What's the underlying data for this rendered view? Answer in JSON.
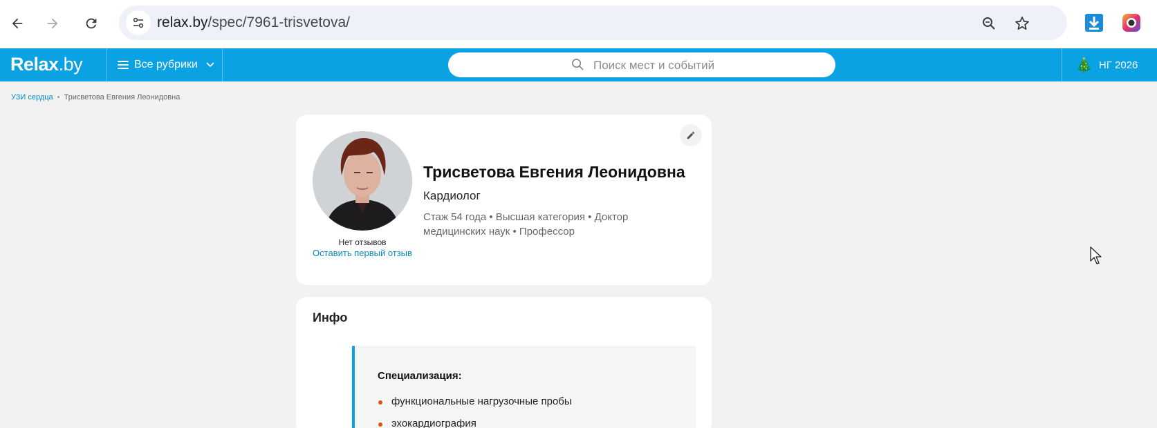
{
  "browser": {
    "url_host": "relax.by",
    "url_path": "/spec/7961-trisvetova/"
  },
  "header": {
    "logo_main": "Relax",
    "logo_tld": ".by",
    "rubrics_label": "Все рубрики",
    "search_placeholder": "Поиск мест и событий",
    "ng_label": "НГ 2026",
    "colors": {
      "brand": "#0aa2e3"
    }
  },
  "breadcrumb": {
    "items": [
      "УЗИ сердца",
      "Трисветова Евгения Леонидовна"
    ]
  },
  "profile": {
    "name": "Трисветова Евгения Леонидовна",
    "profession": "Кардиолог",
    "meta": "Стаж 54 года  •  Высшая категория • Доктор медицинских наук • Профессор",
    "no_reviews": "Нет отзывов",
    "leave_review": "Оставить первый отзыв"
  },
  "info": {
    "title": "Инфо",
    "specialization_title": "Специализация:",
    "specializations": [
      "функциональные нагрузочные пробы",
      "эхокардиография"
    ]
  },
  "icons": {
    "back": "back-arrow-icon",
    "forward": "forward-arrow-icon",
    "reload": "reload-icon",
    "zoom": "zoom-icon",
    "bookmark": "star-icon",
    "download": "download-icon",
    "edit": "pencil-icon"
  }
}
